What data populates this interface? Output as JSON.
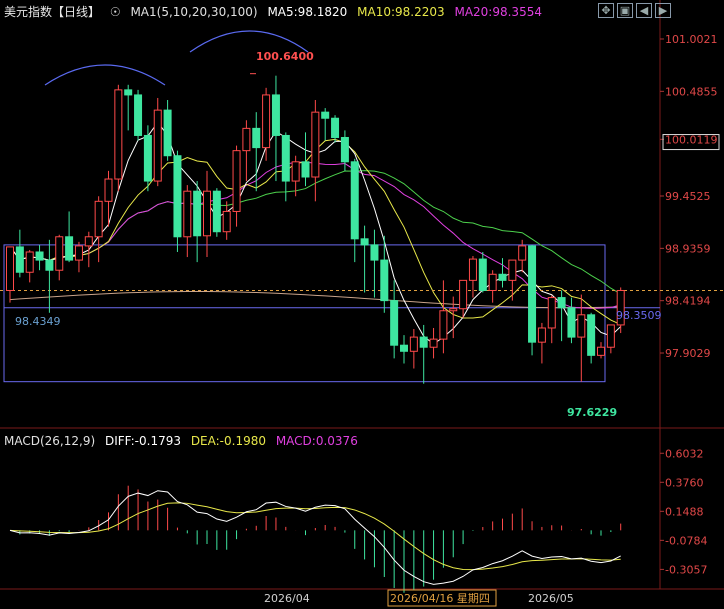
{
  "header": {
    "title": "美元指数【日线】",
    "indicator_icon": "toggle-circle-icon",
    "ma_params": "MA1(5,10,20,30,100)",
    "ma5": "MA5:98.1820",
    "ma10": "MA10:98.2203",
    "ma20": "MA20:98.3554"
  },
  "toolbar": {
    "icons": [
      "move-icon",
      "restore-icon",
      "prev-icon",
      "next-icon"
    ]
  },
  "colors": {
    "up": "#ff4a4a",
    "down": "#3ee6a0",
    "ma5": "#ffffff",
    "ma10": "#e8e84a",
    "ma20": "#e040e0",
    "ma30": "#4cd04c",
    "ma100": "#c9a38a",
    "box": "#6a6af0",
    "diff": "#ffffff",
    "dea": "#e8e84a",
    "macd_label": "#e040e0"
  },
  "chart_data": {
    "type": "candlestick",
    "title": "美元指数【日线】",
    "ylim": [
      97.38,
      101.15
    ],
    "y_ticks": [
      "101.0021",
      "100.4855",
      "100.0119",
      "99.4525",
      "98.9359",
      "98.4194",
      "97.9029"
    ],
    "current_price_label": "98.3509",
    "annotations": {
      "high": "100.6400",
      "low": "97.6229",
      "left": "98.4349"
    },
    "x_labels": [
      "2026/04",
      "2026/04/16 星期四",
      "2026/05"
    ],
    "candles": [
      [
        98.52,
        98.95,
        98.4,
        98.95
      ],
      [
        98.95,
        99.12,
        98.65,
        98.7
      ],
      [
        98.7,
        98.92,
        98.6,
        98.9
      ],
      [
        98.9,
        98.97,
        98.72,
        98.82
      ],
      [
        98.82,
        99.02,
        98.3,
        98.72
      ],
      [
        98.72,
        99.07,
        98.62,
        99.05
      ],
      [
        99.05,
        99.3,
        98.8,
        98.82
      ],
      [
        98.82,
        99.0,
        98.7,
        98.96
      ],
      [
        98.96,
        99.1,
        98.75,
        99.05
      ],
      [
        99.05,
        99.45,
        98.8,
        99.4
      ],
      [
        99.4,
        99.7,
        99.15,
        99.62
      ],
      [
        99.62,
        100.55,
        99.5,
        100.5
      ],
      [
        100.5,
        100.55,
        100.1,
        100.45
      ],
      [
        100.45,
        100.5,
        100.0,
        100.05
      ],
      [
        100.05,
        100.15,
        99.5,
        99.6
      ],
      [
        99.6,
        100.42,
        99.55,
        100.3
      ],
      [
        100.3,
        100.4,
        99.8,
        99.85
      ],
      [
        99.85,
        99.9,
        98.9,
        99.05
      ],
      [
        99.05,
        99.56,
        98.85,
        99.5
      ],
      [
        99.5,
        99.6,
        98.8,
        99.06
      ],
      [
        99.06,
        99.7,
        98.85,
        99.5
      ],
      [
        99.5,
        99.53,
        99.05,
        99.1
      ],
      [
        99.1,
        99.4,
        99.02,
        99.3
      ],
      [
        99.3,
        99.95,
        99.15,
        99.9
      ],
      [
        99.9,
        100.2,
        99.6,
        100.12
      ],
      [
        100.12,
        100.28,
        99.5,
        99.93
      ],
      [
        99.93,
        100.52,
        99.8,
        100.45
      ],
      [
        100.45,
        100.64,
        99.6,
        100.05
      ],
      [
        100.05,
        100.08,
        99.4,
        99.6
      ],
      [
        99.6,
        99.85,
        99.45,
        99.79
      ],
      [
        99.79,
        100.08,
        99.55,
        99.64
      ],
      [
        99.64,
        100.4,
        99.4,
        100.28
      ],
      [
        100.28,
        100.32,
        100.0,
        100.22
      ],
      [
        100.22,
        100.25,
        99.98,
        100.03
      ],
      [
        100.03,
        100.1,
        99.7,
        99.79
      ],
      [
        99.79,
        99.82,
        98.8,
        99.03
      ],
      [
        99.03,
        99.16,
        98.5,
        98.97
      ],
      [
        98.97,
        99.12,
        98.45,
        98.82
      ],
      [
        98.82,
        99.06,
        98.3,
        98.42
      ],
      [
        98.42,
        98.62,
        97.85,
        97.98
      ],
      [
        97.98,
        98.08,
        97.8,
        97.92
      ],
      [
        97.92,
        98.14,
        97.75,
        98.06
      ],
      [
        98.06,
        98.18,
        97.6,
        97.96
      ],
      [
        97.96,
        98.15,
        97.85,
        98.04
      ],
      [
        98.04,
        98.62,
        97.9,
        98.32
      ],
      [
        98.32,
        98.46,
        98.05,
        98.34
      ],
      [
        98.34,
        98.62,
        98.25,
        98.62
      ],
      [
        98.62,
        98.86,
        98.45,
        98.83
      ],
      [
        98.83,
        98.9,
        98.5,
        98.52
      ],
      [
        98.52,
        98.72,
        98.4,
        98.68
      ],
      [
        98.68,
        98.84,
        98.55,
        98.62
      ],
      [
        98.62,
        98.8,
        98.42,
        98.82
      ],
      [
        98.82,
        99.02,
        98.7,
        98.96
      ],
      [
        98.96,
        98.97,
        97.88,
        98.01
      ],
      [
        98.01,
        98.2,
        97.8,
        98.15
      ],
      [
        98.15,
        98.47,
        98.0,
        98.45
      ],
      [
        98.45,
        98.52,
        98.02,
        98.35
      ],
      [
        98.35,
        98.45,
        98.0,
        98.06
      ],
      [
        98.06,
        98.48,
        97.62,
        98.28
      ],
      [
        98.28,
        98.3,
        97.8,
        97.88
      ],
      [
        97.88,
        98.01,
        97.85,
        97.96
      ],
      [
        97.96,
        98.15,
        97.9,
        98.18
      ],
      [
        98.18,
        98.55,
        98.1,
        98.52
      ]
    ],
    "boxes": [
      {
        "x0": 0,
        "x1": 60,
        "y_high": 98.97,
        "y_low": 97.62
      },
      {
        "x0": 0,
        "x1": 60,
        "y_high": 98.35,
        "y_low": 98.35
      }
    ],
    "ma100_level": 98.43,
    "macd": {
      "title": "MACD(26,12,9)",
      "diff_label": "DIFF:-0.1793",
      "dea_label": "DEA:-0.1980",
      "macd_label": "MACD:0.0376",
      "ylim": [
        -0.42,
        0.66
      ],
      "y_ticks": [
        "0.6032",
        "0.3760",
        "0.1488",
        "-0.0784",
        "-0.3057"
      ]
    }
  }
}
